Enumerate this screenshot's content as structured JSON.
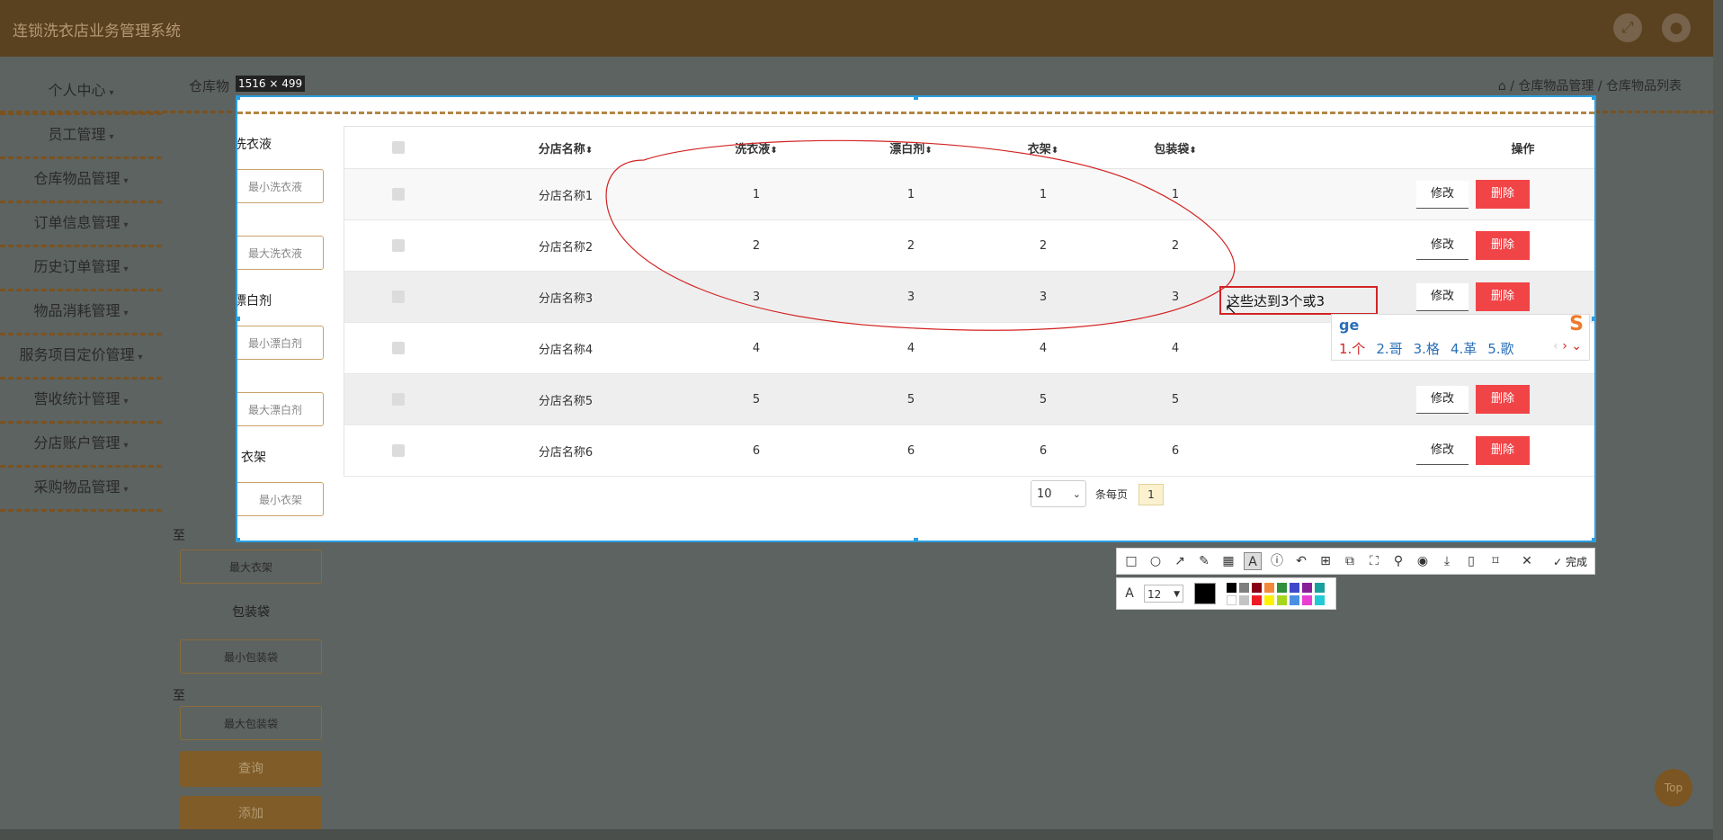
{
  "app": {
    "title": "连锁洗衣店业务管理系统",
    "page_title": "仓库物",
    "breadcrumb": "/ 仓库物品管理 / 仓库物品列表"
  },
  "sidebar": {
    "items": [
      {
        "label": "个人中心"
      },
      {
        "label": "员工管理"
      },
      {
        "label": "仓库物品管理"
      },
      {
        "label": "订单信息管理"
      },
      {
        "label": "历史订单管理"
      },
      {
        "label": "物品消耗管理"
      },
      {
        "label": "服务项目定价管理"
      },
      {
        "label": "营收统计管理"
      },
      {
        "label": "分店账户管理"
      },
      {
        "label": "采购物品管理"
      }
    ]
  },
  "filters": {
    "groups": [
      {
        "label": "洗衣液",
        "min_placeholder": "最小洗衣液",
        "max_placeholder": "最大洗衣液"
      },
      {
        "label": "漂白剂",
        "min_placeholder": "最小漂白剂",
        "max_placeholder": "最大漂白剂"
      },
      {
        "label": "衣架",
        "min_placeholder": "最小衣架",
        "max_placeholder": "最大衣架"
      },
      {
        "label": "包装袋",
        "min_placeholder": "最小包装袋",
        "max_placeholder": "最大包装袋"
      }
    ],
    "to_label": "至",
    "query_button": "查询",
    "add_button": "添加"
  },
  "capture": {
    "size_badge": "1516 × 499"
  },
  "table": {
    "columns": [
      "分店名称",
      "洗衣液",
      "漂白剂",
      "衣架",
      "包装袋",
      "操作"
    ],
    "sort_glyph": "⬍",
    "edit_label": "修改",
    "delete_label": "删除",
    "rows": [
      {
        "name": "分店名称1",
        "detergent": "1",
        "bleach": "1",
        "hanger": "1",
        "bag": "1"
      },
      {
        "name": "分店名称2",
        "detergent": "2",
        "bleach": "2",
        "hanger": "2",
        "bag": "2"
      },
      {
        "name": "分店名称3",
        "detergent": "3",
        "bleach": "3",
        "hanger": "3",
        "bag": "3"
      },
      {
        "name": "分店名称4",
        "detergent": "4",
        "bleach": "4",
        "hanger": "4",
        "bag": "4"
      },
      {
        "name": "分店名称5",
        "detergent": "5",
        "bleach": "5",
        "hanger": "5",
        "bag": "5"
      },
      {
        "name": "分店名称6",
        "detergent": "6",
        "bleach": "6",
        "hanger": "6",
        "bag": "6"
      }
    ]
  },
  "pagination": {
    "page_size": "10",
    "per_page_label": "条每页",
    "current_page": "1"
  },
  "annotation": {
    "text": "这些达到3个或3"
  },
  "ime": {
    "input": "ge",
    "candidates": [
      "1.个",
      "2.哥",
      "3.格",
      "4.革",
      "5.歌"
    ]
  },
  "toolbar": {
    "done_label": "完成",
    "font_size": "12"
  },
  "misc": {
    "top_button": "Top"
  },
  "colors": {
    "accent": "#5a4120",
    "delete": "#f14447",
    "selection": "#2a9fe0",
    "annotation": "#d32323"
  }
}
